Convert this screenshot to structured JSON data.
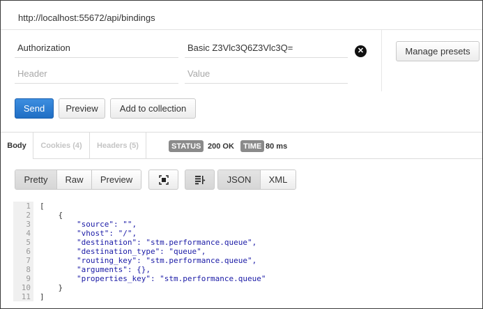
{
  "request": {
    "url": "http://localhost:55672/api/bindings",
    "headers": [
      {
        "key": "Authorization",
        "value": "Basic Z3Vlc3Q6Z3Vlc3Q="
      }
    ],
    "new_header": {
      "key_placeholder": "Header",
      "value_placeholder": "Value"
    },
    "manage_presets_label": "Manage presets",
    "send_label": "Send",
    "preview_label": "Preview",
    "add_to_collection_label": "Add to collection"
  },
  "response": {
    "tabs": [
      {
        "label": "Body",
        "active": true
      },
      {
        "label": "Cookies (4)",
        "active": false
      },
      {
        "label": "Headers (5)",
        "active": false
      }
    ],
    "status_label": "STATUS",
    "status_value": "200 OK",
    "time_label": "TIME",
    "time_value": "80 ms",
    "view_modes": [
      "Pretty",
      "Raw",
      "Preview"
    ],
    "active_view": "Pretty",
    "formats": [
      "JSON",
      "XML"
    ],
    "active_format": "JSON",
    "toolbar_icons": [
      "expand-icon",
      "wrap-lines-icon"
    ]
  },
  "code_lines": [
    {
      "n": "1",
      "t": "["
    },
    {
      "n": "2",
      "t": "    {"
    },
    {
      "n": "3",
      "t": "        \"source\": \"\","
    },
    {
      "n": "4",
      "t": "        \"vhost\": \"/\","
    },
    {
      "n": "5",
      "t": "        \"destination\": \"stm.performance.queue\","
    },
    {
      "n": "6",
      "t": "        \"destination_type\": \"queue\","
    },
    {
      "n": "7",
      "t": "        \"routing_key\": \"stm.performance.queue\","
    },
    {
      "n": "8",
      "t": "        \"arguments\": {},"
    },
    {
      "n": "9",
      "t": "        \"properties_key\": \"stm.performance.queue\""
    },
    {
      "n": "10",
      "t": "    }"
    },
    {
      "n": "11",
      "t": "]"
    }
  ],
  "colors": {
    "send_button": "#2a7fd4",
    "json_key": "#1a1aa6",
    "gutter_bg": "#f0f0f0"
  }
}
